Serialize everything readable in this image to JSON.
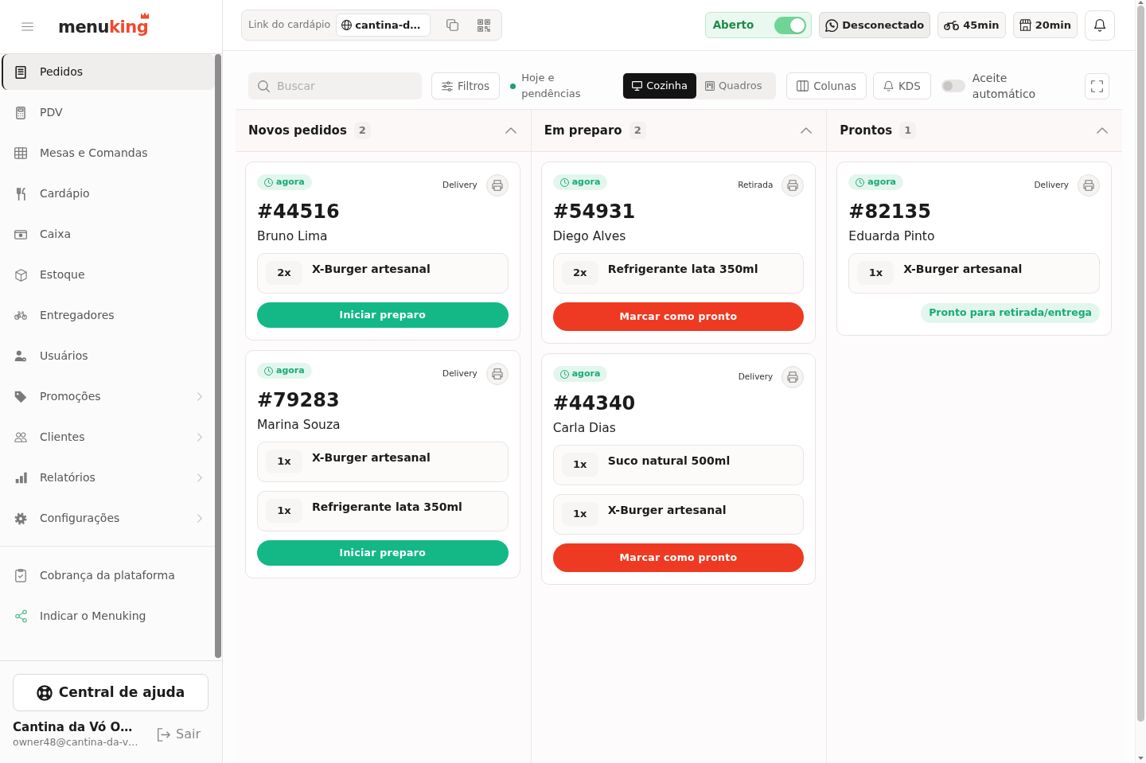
{
  "sidebar": {
    "brand": [
      "menu",
      "king"
    ],
    "nav_items": [
      {
        "label": "Pedidos",
        "selected": true,
        "submenu": false
      },
      {
        "label": "PDV",
        "selected": false,
        "submenu": false
      },
      {
        "label": "Mesas e Comandas",
        "selected": false,
        "submenu": false
      },
      {
        "label": "Cardápio",
        "selected": false,
        "submenu": false
      },
      {
        "label": "Caixa",
        "selected": false,
        "submenu": false
      },
      {
        "label": "Estoque",
        "selected": false,
        "submenu": false
      },
      {
        "label": "Entregadores",
        "selected": false,
        "submenu": false
      },
      {
        "label": "Usuários",
        "selected": false,
        "submenu": false
      },
      {
        "label": "Promoções",
        "selected": false,
        "submenu": true
      },
      {
        "label": "Clientes",
        "selected": false,
        "submenu": true
      },
      {
        "label": "Relatórios",
        "selected": false,
        "submenu": true
      },
      {
        "label": "Configurações",
        "selected": false,
        "submenu": true
      }
    ],
    "extra_items": [
      {
        "label": "Cobrança da plataforma",
        "selected": false
      },
      {
        "label": "Indicar o Menuking",
        "selected": false
      }
    ],
    "help_button": "Central de ajuda",
    "account": {
      "name": "Cantina da Vó O…",
      "email": "owner48@cantina-da-v…"
    },
    "logout": "Sair"
  },
  "header": {
    "menu_link": {
      "label": "Link do cardápio",
      "value": "cantina-d…"
    },
    "store_status": {
      "label": "Aberto",
      "on": true
    },
    "whatsapp": "Desconectado",
    "delivery_time": "45min",
    "pickup_time": "20min"
  },
  "toolbar": {
    "search": {
      "placeholder": "Buscar"
    },
    "filters": "Filtros",
    "period": "Hoje e pendências",
    "views": [
      {
        "label": "Cozinha",
        "selected": true
      },
      {
        "label": "Quadros",
        "selected": false
      }
    ],
    "columns_button": "Colunas",
    "kds_button": "KDS",
    "auto_accept": {
      "label": "Aceite automático",
      "on": false
    }
  },
  "columns": [
    {
      "title": "Novos pedidos",
      "count": "2",
      "expanded": true,
      "orders": [
        {
          "time": "agora",
          "type": "Delivery",
          "number": "#44516",
          "customer": "Bruno Lima",
          "items": [
            {
              "quantity": "2x",
              "name": "X-Burger artesanal"
            }
          ],
          "action": {
            "kind": "start",
            "label": "Iniciar preparo"
          }
        },
        {
          "time": "agora",
          "type": "Delivery",
          "number": "#79283",
          "customer": "Marina Souza",
          "items": [
            {
              "quantity": "1x",
              "name": "X-Burger artesanal"
            },
            {
              "quantity": "1x",
              "name": "Refrigerante lata 350ml"
            }
          ],
          "action": {
            "kind": "start",
            "label": "Iniciar preparo"
          }
        }
      ]
    },
    {
      "title": "Em preparo",
      "count": "2",
      "expanded": true,
      "orders": [
        {
          "time": "agora",
          "type": "Retirada",
          "number": "#54931",
          "customer": "Diego Alves",
          "items": [
            {
              "quantity": "2x",
              "name": "Refrigerante lata 350ml"
            }
          ],
          "action": {
            "kind": "finish",
            "label": "Marcar como pronto"
          }
        },
        {
          "time": "agora",
          "type": "Delivery",
          "number": "#44340",
          "customer": "Carla Dias",
          "items": [
            {
              "quantity": "1x",
              "name": "Suco natural 500ml"
            },
            {
              "quantity": "1x",
              "name": "X-Burger artesanal"
            }
          ],
          "action": {
            "kind": "finish",
            "label": "Marcar como pronto"
          }
        }
      ]
    },
    {
      "title": "Prontos",
      "count": "1",
      "expanded": true,
      "orders": [
        {
          "time": "agora",
          "type": "Delivery",
          "number": "#82135",
          "customer": "Eduarda Pinto",
          "items": [
            {
              "quantity": "1x",
              "name": "X-Burger artesanal"
            }
          ],
          "action": {
            "kind": "status",
            "label": "Pronto para retirada/entrega"
          }
        }
      ]
    }
  ]
}
